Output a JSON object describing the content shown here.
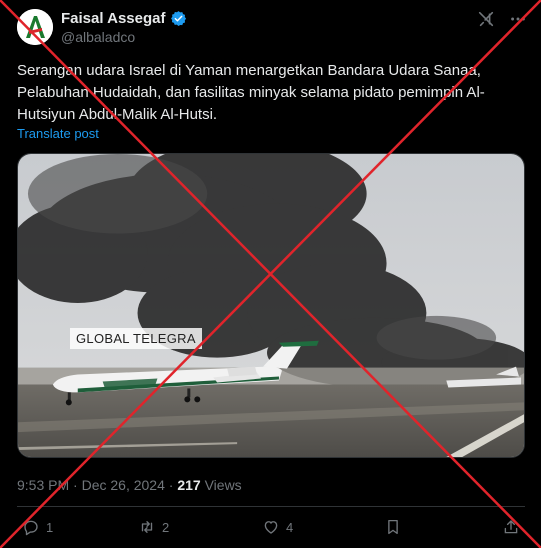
{
  "author": {
    "display_name": "Faisal Assegaf",
    "handle": "@albaladco",
    "avatar_letter": "A",
    "verified": true
  },
  "tweet": {
    "text": "Serangan udara Israel di Yaman menargetkan Bandara Udara Sanaa, Pelabuhan Hudaidah, dan fasilitas minyak selama pidato pemimpin Al-Hutsiyun Abdul-Malik Al-Hutsi.",
    "translate_label": "Translate post"
  },
  "media": {
    "watermark": "GLOBAL TELEGRA",
    "description_icon": "airport-smoke-photo"
  },
  "meta": {
    "time": "9:53 PM",
    "separator": "·",
    "date": "Dec 26, 2024",
    "views_count": "217",
    "views_label": "Views"
  },
  "actions": {
    "replies": "1",
    "reposts": "2",
    "likes": "4"
  },
  "icons": [
    "grok-icon",
    "more-icon",
    "reply-icon",
    "repost-icon",
    "like-icon",
    "bookmark-icon",
    "share-icon",
    "verified-badge-icon"
  ],
  "colors": {
    "background": "#000000",
    "text": "#e7e9ea",
    "muted": "#71767b",
    "link": "#1d9bf0",
    "cross": "#e0242b"
  }
}
